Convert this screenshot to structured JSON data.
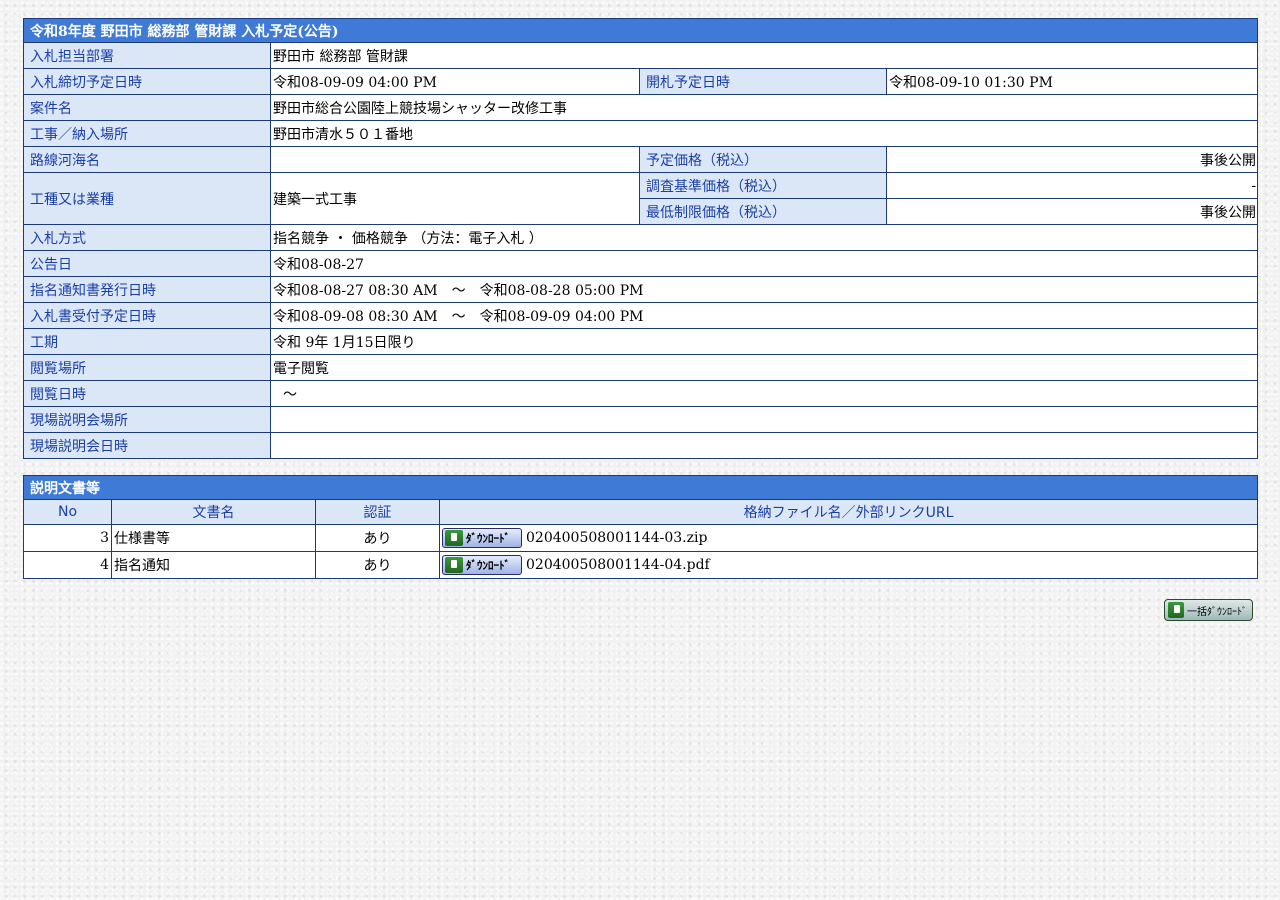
{
  "page_title": "令和8年度 野田市 総務部 管財課 入札予定(公告)",
  "labels": {
    "dept": "入札担当部署",
    "deadline": "入札締切予定日時",
    "opening": "開札予定日時",
    "project": "案件名",
    "location": "工事／納入場所",
    "route": "路線河海名",
    "planned_price": "予定価格（税込）",
    "work_type": "工種又は業種",
    "survey_price": "調査基準価格（税込）",
    "min_price": "最低制限価格（税込）",
    "method": "入札方式",
    "announce_date": "公告日",
    "notice_issue": "指名通知書発行日時",
    "bid_accept": "入札書受付予定日時",
    "period": "工期",
    "view_place": "閲覧場所",
    "view_date": "閲覧日時",
    "site_place": "現場説明会場所",
    "site_date": "現場説明会日時"
  },
  "values": {
    "dept": "野田市 総務部 管財課",
    "deadline": "令和08-09-09 04:00 PM",
    "opening": "令和08-09-10 01:30 PM",
    "project": "野田市総合公園陸上競技場シャッター改修工事",
    "location": "野田市清水５０１番地",
    "route": "",
    "planned_price": "事後公開",
    "work_type": "建築一式工事",
    "survey_price": "-",
    "min_price": "事後公開",
    "method": "指名競争 ・ 価格競争 （方法：電子入札 ）",
    "announce_date": "令和08-08-27",
    "notice_issue": "令和08-08-27 08:30 AM　～　令和08-08-28 05:00 PM",
    "bid_accept": "令和08-09-08 08:30 AM　～　令和08-09-09 04:00 PM",
    "period": "令和 9年 1月15日限り",
    "view_place": "電子閲覧",
    "view_date": "～",
    "site_place": "",
    "site_date": ""
  },
  "docs": {
    "title": "説明文書等",
    "headers": [
      "No",
      "文書名",
      "認証",
      "格納ファイル名／外部リンクURL"
    ],
    "download_label": "ﾀﾞｳﾝﾛｰﾄﾞ",
    "rows": [
      {
        "no": "3",
        "name": "仕様書等",
        "auth": "あり",
        "file": "020400508001144-03.zip"
      },
      {
        "no": "4",
        "name": "指名通知",
        "auth": "あり",
        "file": "020400508001144-04.pdf"
      }
    ]
  },
  "bulk_download_label": "一括ﾀﾞｳﾝﾛｰﾄﾞ",
  "colors": {
    "header": "#3f7ad6",
    "label_bg": "#dbe6f6",
    "label_text": "#1a3faa"
  }
}
